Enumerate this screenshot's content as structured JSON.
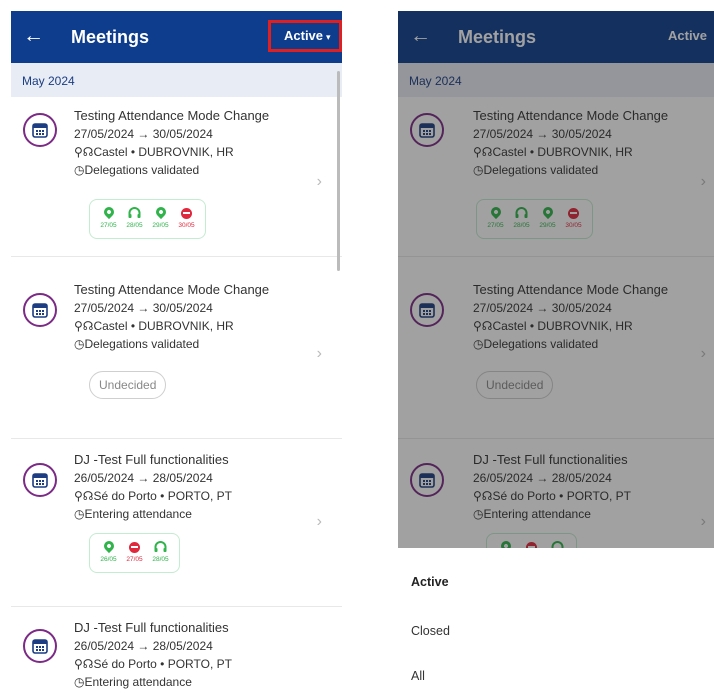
{
  "header": {
    "back_icon": "←",
    "title": "Meetings",
    "filter_label": "Active",
    "filter_caret": "▾"
  },
  "month_label": "May 2024",
  "meetings": [
    {
      "title": "Testing Attendance Mode Change",
      "dates": "27/05/2024 → 30/05/2024",
      "location": "Castel • DUBROVNIK, HR",
      "status": "Delegations validated",
      "attendance": [
        {
          "type": "location",
          "date": "27/05"
        },
        {
          "type": "headset",
          "date": "28/05"
        },
        {
          "type": "location",
          "date": "29/05"
        },
        {
          "type": "absent",
          "date": "30/05"
        }
      ]
    },
    {
      "title": "Testing Attendance Mode Change",
      "dates": "27/05/2024 → 30/05/2024",
      "location": "Castel • DUBROVNIK, HR",
      "status": "Delegations validated",
      "badge": "Undecided"
    },
    {
      "title": "DJ -Test Full functionalities",
      "dates": "26/05/2024 → 28/05/2024",
      "location": "Sé do Porto • PORTO, PT",
      "status": "Entering attendance",
      "attendance": [
        {
          "type": "location",
          "date": "26/05"
        },
        {
          "type": "absent",
          "date": "27/05"
        },
        {
          "type": "headset",
          "date": "28/05"
        }
      ]
    },
    {
      "title": "DJ -Test Full functionalities",
      "dates": "26/05/2024 → 28/05/2024",
      "location": "Sé do Porto • PORTO, PT",
      "status": "Entering attendance"
    }
  ],
  "filter_menu": {
    "options": [
      "Active",
      "Closed",
      "All"
    ],
    "selected": "Active"
  },
  "icons": {
    "location": "📍",
    "headset": "🎧",
    "clock": "◷",
    "chevron": "›"
  },
  "colors": {
    "header": "#0d3d8c",
    "accent_purple": "#7b2a85",
    "present": "#2fb34a",
    "absent": "#e0273b",
    "highlight": "#e02020"
  }
}
